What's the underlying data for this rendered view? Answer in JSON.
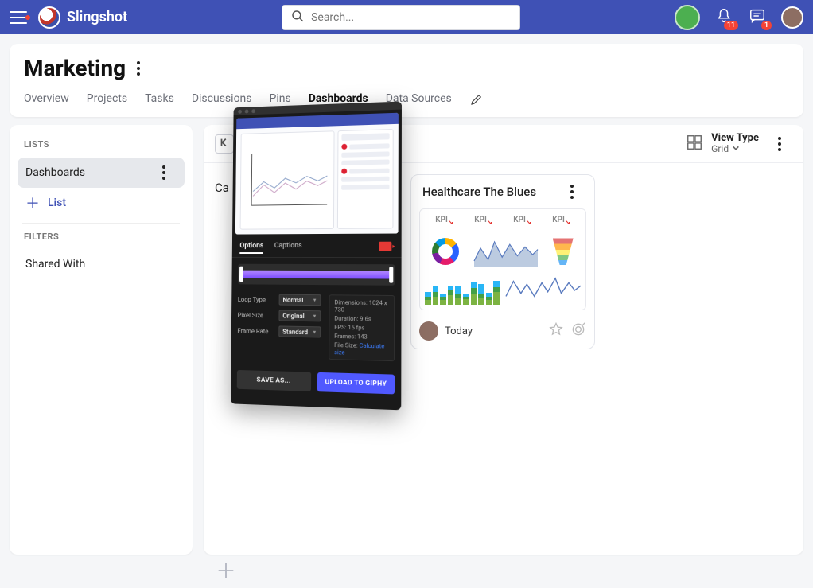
{
  "brand": {
    "name": "Slingshot"
  },
  "search": {
    "placeholder": "Search..."
  },
  "notifications": {
    "bell_count": "11",
    "chat_count": "1"
  },
  "page": {
    "title": "Marketing"
  },
  "tabs": [
    {
      "label": "Overview"
    },
    {
      "label": "Projects"
    },
    {
      "label": "Tasks"
    },
    {
      "label": "Discussions"
    },
    {
      "label": "Pins"
    },
    {
      "label": "Dashboards",
      "active": true
    },
    {
      "label": "Data Sources"
    }
  ],
  "sidebar": {
    "lists_label": "LISTS",
    "items": [
      {
        "label": "Dashboards",
        "active": true
      }
    ],
    "add_label": "List",
    "filters_label": "FILTERS",
    "filter_items": [
      {
        "label": "Shared With"
      }
    ]
  },
  "viewtype": {
    "label": "View Type",
    "value": "Grid"
  },
  "cards": {
    "partial": {
      "title_fragment": "Ca"
    },
    "healthcare": {
      "title": "Healthcare The Blues",
      "kpi_label": "KPI",
      "footer": "Today"
    }
  },
  "add_card": {},
  "capture_panel": {
    "tabs": {
      "options": "Options",
      "captions": "Captions"
    },
    "fields": {
      "loop_type": {
        "label": "Loop Type",
        "value": "Normal"
      },
      "pixel_size": {
        "label": "Pixel Size",
        "value": "Original"
      },
      "frame_rate": {
        "label": "Frame Rate",
        "value": "Standard"
      }
    },
    "meta": {
      "dimensions": "Dimensions: 1024 x 730",
      "duration": "Duration: 9.6s",
      "fps": "FPS: 15 fps",
      "frames": "Frames: 143",
      "filesize_label": "File Size:",
      "filesize_link": "Calculate size"
    },
    "buttons": {
      "save": "SAVE AS...",
      "upload": "UPLOAD TO GIPHY"
    }
  }
}
